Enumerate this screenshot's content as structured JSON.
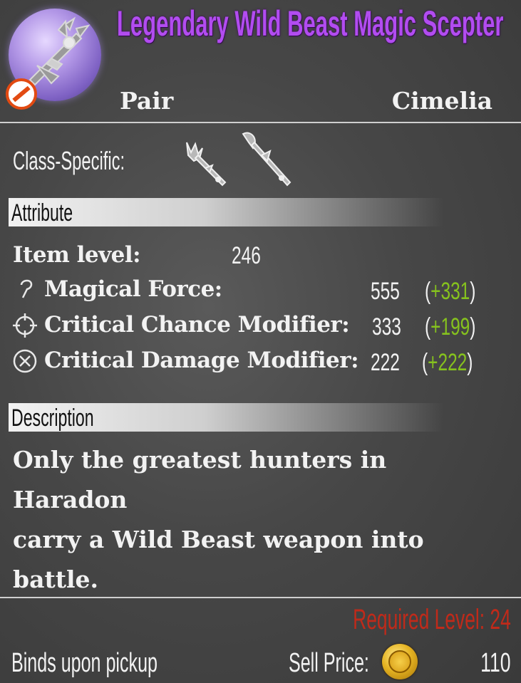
{
  "item": {
    "name": "Legendary Wild Beast Magic Scepter",
    "pair_label": "Pair",
    "rarity": "Cimelia",
    "class_specific_label": "Class-Specific:",
    "icon": "scepter-icon",
    "restriction_icon": "no-entry-icon"
  },
  "sections": {
    "attribute": "Attribute",
    "description": "Description"
  },
  "item_level": {
    "label": "Item level:",
    "value": "246"
  },
  "attributes": [
    {
      "icon": "staff-icon",
      "label": "Magical Force:",
      "value": "555",
      "bonus_open": "(",
      "bonus": "+331",
      "bonus_close": ")"
    },
    {
      "icon": "crosshair-icon",
      "label": "Critical Chance Modifier:",
      "value": "333",
      "bonus_open": "(",
      "bonus": "+199",
      "bonus_close": ")"
    },
    {
      "icon": "circled-x-icon",
      "label": "Critical Damage Modifier:",
      "value": "222",
      "bonus_open": "(",
      "bonus": "+222",
      "bonus_close": ")"
    }
  ],
  "description": {
    "line1": "Only the greatest hunters in Haradon",
    "line2": "carry a Wild Beast weapon into battle."
  },
  "footer": {
    "required_level": "Required Level: 24",
    "binds": "Binds upon pickup",
    "sell_label": "Sell Price:",
    "sell_price": "110",
    "currency_icon": "gold-coin-icon"
  },
  "colors": {
    "title": "#b24cf0",
    "bonus": "#86c21e",
    "required": "#c02a1a"
  }
}
